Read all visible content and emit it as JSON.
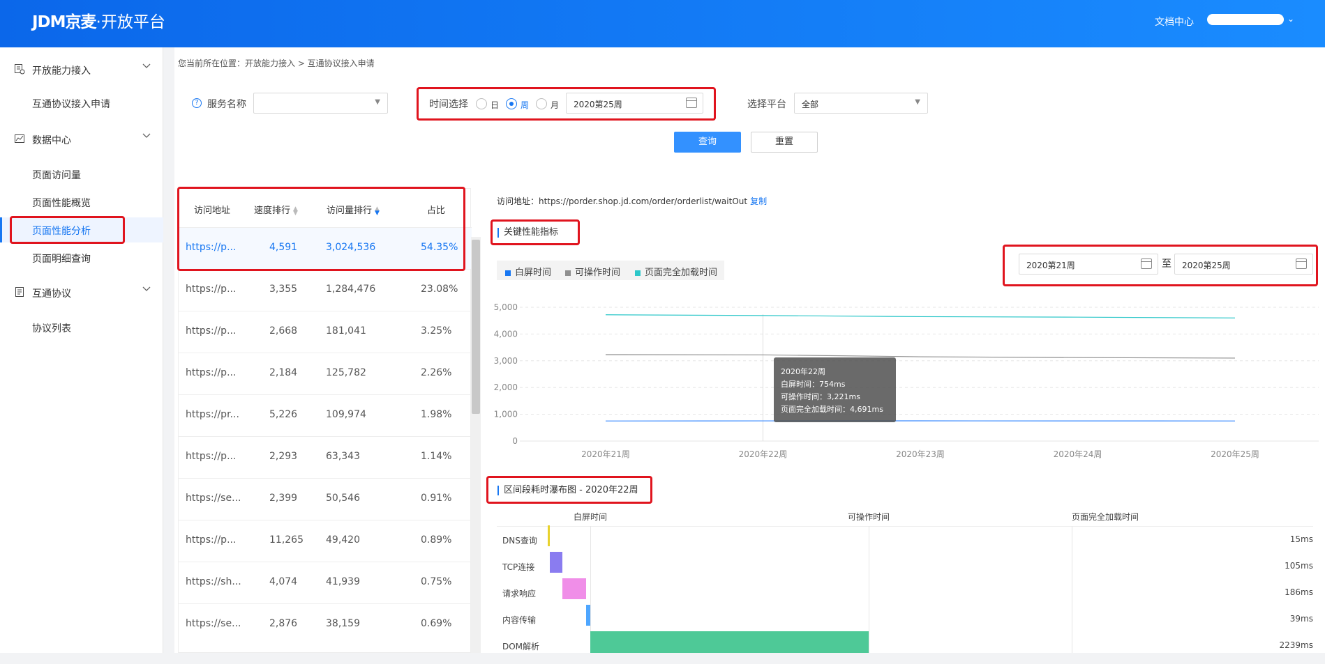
{
  "header": {
    "logo_brand": "JDM京麦",
    "logo_sep": "·",
    "logo_product": "开放平台",
    "doc_center": "文档中心",
    "user_chevron": "⌄"
  },
  "sidebar": {
    "groups": [
      {
        "label": "开放能力接入",
        "icon": "grid-doc-icon"
      },
      {
        "label": "数据中心",
        "icon": "chart-icon"
      },
      {
        "label": "互通协议",
        "icon": "doc-list-icon"
      }
    ],
    "items": [
      {
        "label": "互通协议接入申请"
      },
      {
        "label": "页面访问量"
      },
      {
        "label": "页面性能概览"
      },
      {
        "label": "页面性能分析"
      },
      {
        "label": "页面明细查询"
      },
      {
        "label": "协议列表"
      }
    ]
  },
  "breadcrumb": "您当前所在位置：开放能力接入 > 互通协议接入申请",
  "filters": {
    "service_label": "服务名称",
    "service_value": "",
    "time_label": "时间选择",
    "radio_day": "日",
    "radio_week": "周",
    "radio_month": "月",
    "week_value": "2020第25周",
    "platform_label": "选择平台",
    "platform_value": "全部",
    "query_button": "查询",
    "reset_button": "重置"
  },
  "table": {
    "headers": {
      "url": "访问地址",
      "speed": "速度排行",
      "visits": "访问量排行",
      "ratio": "占比"
    },
    "rows": [
      {
        "url": "https://p...",
        "speed": "4,591",
        "visits": "3,024,536",
        "ratio": "54.35%"
      },
      {
        "url": "https://p...",
        "speed": "3,355",
        "visits": "1,284,476",
        "ratio": "23.08%"
      },
      {
        "url": "https://p...",
        "speed": "2,668",
        "visits": "181,041",
        "ratio": "3.25%"
      },
      {
        "url": "https://p...",
        "speed": "2,184",
        "visits": "125,782",
        "ratio": "2.26%"
      },
      {
        "url": "https://pr...",
        "speed": "5,226",
        "visits": "109,974",
        "ratio": "1.98%"
      },
      {
        "url": "https://p...",
        "speed": "2,293",
        "visits": "63,343",
        "ratio": "1.14%"
      },
      {
        "url": "https://se...",
        "speed": "2,399",
        "visits": "50,546",
        "ratio": "0.91%"
      },
      {
        "url": "https://p...",
        "speed": "11,265",
        "visits": "49,420",
        "ratio": "0.89%"
      },
      {
        "url": "https://sh...",
        "speed": "4,074",
        "visits": "41,939",
        "ratio": "0.75%"
      },
      {
        "url": "https://se...",
        "speed": "2,876",
        "visits": "38,159",
        "ratio": "0.69%"
      }
    ]
  },
  "detail": {
    "url_prefix": "访问地址：https://porder.shop.jd.com/order/orderlist/waitOut",
    "copy": "复制",
    "kpi_title": "关键性能指标",
    "range_from": "2020第21周",
    "range_sep": "至",
    "range_to": "2020第25周",
    "waterfall_title": "区间段耗时瀑布图 - 2020年22周"
  },
  "chart_data": {
    "type": "line",
    "x": [
      "2020年21周",
      "2020年22周",
      "2020年23周",
      "2020年24周",
      "2020年25周"
    ],
    "ylim": [
      0,
      5000
    ],
    "yticks": [
      "0",
      "1,000",
      "2,000",
      "3,000",
      "4,000",
      "5,000"
    ],
    "series": [
      {
        "name": "白屏时间",
        "color": "#3b8bff",
        "values": [
          750,
          754,
          755,
          752,
          750
        ]
      },
      {
        "name": "可操作时间",
        "color": "#8f8f8f",
        "values": [
          3230,
          3221,
          3150,
          3120,
          3100
        ]
      },
      {
        "name": "页面完全加载时间",
        "color": "#2dc7c9",
        "values": [
          4720,
          4691,
          4650,
          4630,
          4600
        ]
      }
    ],
    "tooltip": {
      "title": "2020年22周",
      "line1": "白屏时间：754ms",
      "line2": "可操作时间：3,221ms",
      "line3": "页面完全加载时间：4,691ms"
    }
  },
  "waterfall": {
    "headers": [
      "白屏时间",
      "可操作时间",
      "页面完全加载时间"
    ],
    "rows": [
      {
        "name": "DNS查询",
        "duration": "15ms",
        "color": "#e8d22d"
      },
      {
        "name": "TCP连接",
        "duration": "105ms",
        "color": "#8a7cf0"
      },
      {
        "name": "请求响应",
        "duration": "186ms",
        "color": "#f08ee8"
      },
      {
        "name": "内容传输",
        "duration": "39ms",
        "color": "#4ea6ff"
      },
      {
        "name": "DOM解析",
        "duration": "2239ms",
        "color": "#4ec997"
      }
    ]
  }
}
